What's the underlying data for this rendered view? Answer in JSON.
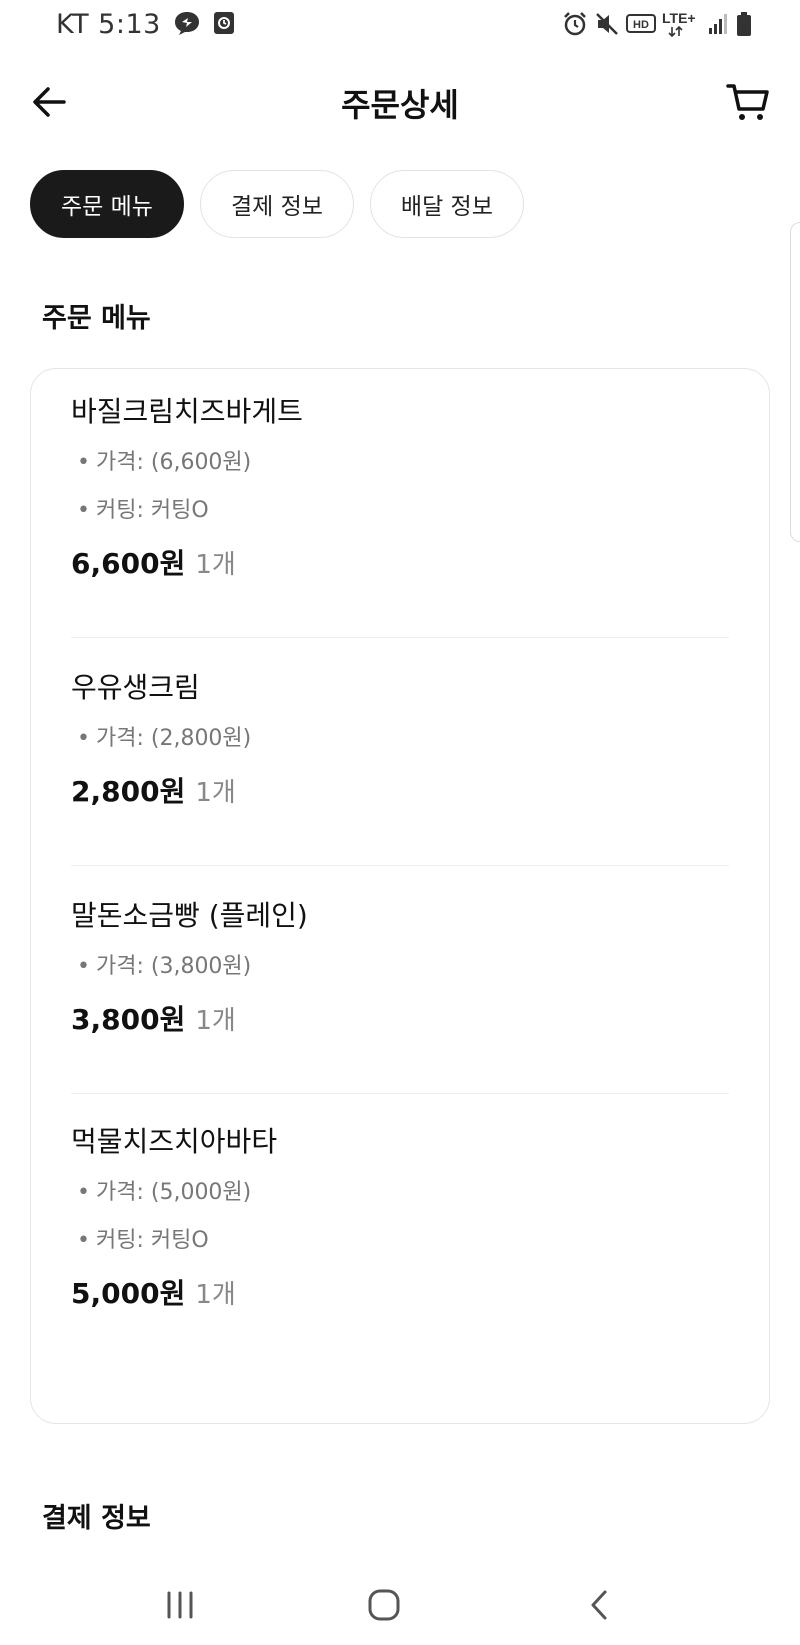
{
  "status_bar": {
    "carrier_time": "KT 5:13",
    "network": "LTE+"
  },
  "app_bar": {
    "title": "주문상세"
  },
  "tabs": [
    {
      "label": "주문 메뉴",
      "active": true
    },
    {
      "label": "결제 정보",
      "active": false
    },
    {
      "label": "배달 정보",
      "active": false
    }
  ],
  "order_menu": {
    "heading": "주문 메뉴",
    "items": [
      {
        "name": "바질크림치즈바게트",
        "options": [
          "가격:  (6,600원)",
          "커팅: 커팅O"
        ],
        "price": "6,600원",
        "quantity": "1개"
      },
      {
        "name": "우유생크림",
        "options": [
          "가격:  (2,800원)"
        ],
        "price": "2,800원",
        "quantity": "1개"
      },
      {
        "name": "말돈소금빵 (플레인)",
        "options": [
          "가격:  (3,800원)"
        ],
        "price": "3,800원",
        "quantity": "1개"
      },
      {
        "name": "먹물치즈치아바타",
        "options": [
          "가격:  (5,000원)",
          "커팅: 커팅O"
        ],
        "price": "5,000원",
        "quantity": "1개"
      }
    ]
  },
  "payment_info": {
    "heading": "결제 정보"
  },
  "colors": {
    "active_tab_bg": "#1a1a1a",
    "border": "#e5e5e5",
    "secondary_text": "#777777"
  },
  "icons": {
    "back": "arrow-left-icon",
    "cart": "cart-icon",
    "nav_recents": "recents-icon",
    "nav_home": "home-icon",
    "nav_back": "chevron-left-icon"
  }
}
